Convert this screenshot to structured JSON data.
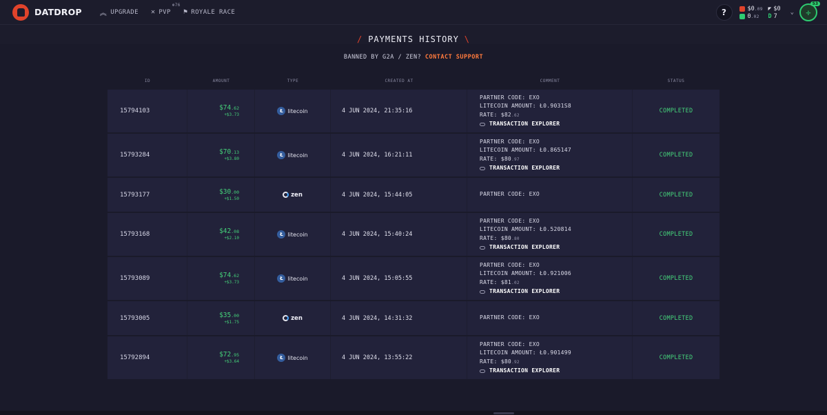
{
  "header": {
    "brand": "DATDROP",
    "nav": [
      {
        "label": "UPGRADE",
        "icon": "chevron-up-icon"
      },
      {
        "label": "PVP",
        "icon": "crossed-swords-icon",
        "sup": "76"
      },
      {
        "label": "ROYALE RACE",
        "icon": "flag-icon"
      }
    ],
    "help": "?",
    "balances": [
      {
        "main": "$0",
        "small": ".09",
        "color": "#e0432b"
      },
      {
        "main": "$0",
        "small": "",
        "color": "#e6e6f0"
      },
      {
        "main": "0",
        "small": ".02",
        "color": "#2ecc71"
      },
      {
        "main": "7",
        "small": "",
        "color": "#2ecc71"
      }
    ],
    "avatar_level": "53"
  },
  "page": {
    "title": "PAYMENTS HISTORY",
    "banned_text": "BANNED BY G2A / ZEN?",
    "contact_link": "CONTACT SUPPORT"
  },
  "table": {
    "headers": {
      "id": "ID",
      "amount": "AMOUNT",
      "type": "TYPE",
      "created": "CREATED AT",
      "comment": "COMMENT",
      "status": "STATUS"
    },
    "rows": [
      {
        "id": "15794103",
        "amount": "$74",
        "cents": ".62",
        "bonus": "+$3.73",
        "type": "litecoin",
        "created": "4 JUN 2024, 21:35:16",
        "partner": "PARTNER CODE: EXO",
        "ltc_amount": "LITECOIN AMOUNT: Ł0.9031S8",
        "rate": "RATE: $82",
        "rate_small": ".62",
        "tx": "TRANSACTION EXPLORER",
        "status": "COMPLETED"
      },
      {
        "id": "15793284",
        "amount": "$70",
        "cents": ".13",
        "bonus": "+$3.80",
        "type": "litecoin",
        "created": "4 JUN 2024, 16:21:11",
        "partner": "PARTNER CODE: EXO",
        "ltc_amount": "LITECOIN AMOUNT: Ł0.865147",
        "rate": "RATE: $80",
        "rate_small": ".97",
        "tx": "TRANSACTION EXPLORER",
        "status": "COMPLETED"
      },
      {
        "id": "15793177",
        "amount": "$30",
        "cents": ".00",
        "bonus": "+$1.50",
        "type": "zen",
        "created": "4 JUN 2024, 15:44:05",
        "partner": "PARTNER CODE: EXO",
        "ltc_amount": "",
        "rate": "",
        "rate_small": "",
        "tx": "",
        "status": "COMPLETED"
      },
      {
        "id": "15793168",
        "amount": "$42",
        "cents": ".08",
        "bonus": "+$2.10",
        "type": "litecoin",
        "created": "4 JUN 2024, 15:40:24",
        "partner": "PARTNER CODE: EXO",
        "ltc_amount": "LITECOIN AMOUNT: Ł0.520814",
        "rate": "RATE: $80",
        "rate_small": ".80",
        "tx": "TRANSACTION EXPLORER",
        "status": "COMPLETED"
      },
      {
        "id": "15793089",
        "amount": "$74",
        "cents": ".62",
        "bonus": "+$3.73",
        "type": "litecoin",
        "created": "4 JUN 2024, 15:05:55",
        "partner": "PARTNER CODE: EXO",
        "ltc_amount": "LITECOIN AMOUNT: Ł0.921006",
        "rate": "RATE: $81",
        "rate_small": ".02",
        "tx": "TRANSACTION EXPLORER",
        "status": "COMPLETED"
      },
      {
        "id": "15793005",
        "amount": "$35",
        "cents": ".00",
        "bonus": "+$1.75",
        "type": "zen",
        "created": "4 JUN 2024, 14:31:32",
        "partner": "PARTNER CODE: EXO",
        "ltc_amount": "",
        "rate": "",
        "rate_small": "",
        "tx": "",
        "status": "COMPLETED"
      },
      {
        "id": "15792894",
        "amount": "$72",
        "cents": ".95",
        "bonus": "+$3.64",
        "type": "litecoin",
        "created": "4 JUN 2024, 13:55:22",
        "partner": "PARTNER CODE: EXO",
        "ltc_amount": "LITECOIN AMOUNT: Ł0.901499",
        "rate": "RATE: $80",
        "rate_small": ".92",
        "tx": "TRANSACTION EXPLORER",
        "status": "COMPLETED"
      }
    ]
  },
  "type_labels": {
    "litecoin": "litecoin",
    "zen": "zen"
  }
}
